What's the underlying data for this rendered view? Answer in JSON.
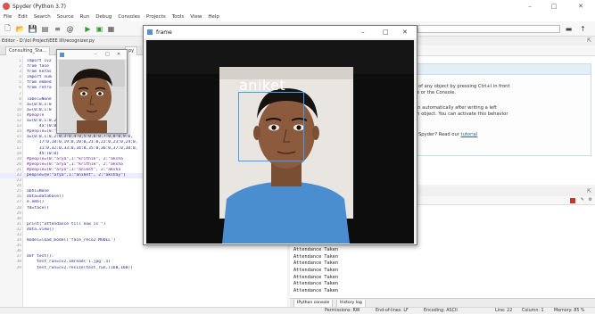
{
  "window": {
    "title": "Spyder (Python 3.7)",
    "controls": {
      "minimize": "–",
      "maximize": "□",
      "close": "✕"
    }
  },
  "menu": [
    "File",
    "Edit",
    "Search",
    "Source",
    "Run",
    "Debug",
    "Consoles",
    "Projects",
    "Tools",
    "View",
    "Help"
  ],
  "editor": {
    "path": "Editor - D:\\lol Project\\EEE III\\recognizer.py",
    "tab_label": "Consulting_Sta...",
    "tab_label2": "py",
    "lines": [
      {
        "n": "1",
        "t": "import cv2"
      },
      {
        "n": "2",
        "t": "from face"
      },
      {
        "n": "3",
        "t": "from keras"
      },
      {
        "n": "4",
        "t": "import num"
      },
      {
        "n": "5",
        "t": "from embed"
      },
      {
        "n": "6",
        "t": "from retra                     data"
      },
      {
        "n": "7",
        "t": ""
      },
      {
        "n": "8",
        "t": "label=None"
      },
      {
        "n": "9",
        "t": "a={0:0,1:0"
      },
      {
        "n": "10",
        "t": "a={0:0,1:0"
      },
      {
        "n": "11",
        "t": "#people"
      },
      {
        "n": "12",
        "t": "a={0:0,1:0,2:0,3:0,4:0"
      },
      {
        "n": "13",
        "t": "     4a:{0:0}"
      },
      {
        "n": "14",
        "t": "#people={0:\"vs\",1:\"rohit\",2:\"krlinin\",3:\""
      },
      {
        "n": "15",
        "t": "a={0:0,1:0,2:0,3:0,4:0,5:0,6:0,7:0,8:0,9:0,"
      },
      {
        "n": "16",
        "t": "     17:0,18:0,19:0,20:0,21:0,22:0,23:0,24:0,"
      },
      {
        "n": "17",
        "t": "     31:0,32:0,33:0,34:0,35:0,36:0,37:0,38:0,"
      },
      {
        "n": "18",
        "t": "     45:{0:0}"
      },
      {
        "n": "19",
        "t": "#people={0:\"arya\",1:\"krithik\", 2:\"aksha"
      },
      {
        "n": "20",
        "t": "#people={0:\"arya\",1:\"krithik\", 2:\"aksha"
      },
      {
        "n": "21",
        "t": "#people={0:\"arya\",1:\"aniket\", 2:\"aksha"
      },
      {
        "n": "22",
        "t": "people={0:\"arya\",1:\"aniket\", 2:\"akshay\"}"
      },
      {
        "n": "23",
        "t": ""
      },
      {
        "n": "24",
        "t": ""
      },
      {
        "n": "25",
        "t": "abhi=None"
      },
      {
        "n": "26",
        "t": "data=database()"
      },
      {
        "n": "27",
        "t": "e.emb()"
      },
      {
        "n": "28",
        "t": "fd=face()"
      },
      {
        "n": "29",
        "t": ""
      },
      {
        "n": "30",
        "t": ""
      },
      {
        "n": "31",
        "t": "print(\"attendance till now is \")"
      },
      {
        "n": "32",
        "t": "data.view()"
      },
      {
        "n": "33",
        "t": ""
      },
      {
        "n": "34",
        "t": "model=load_model('face_reco2.MODEL')"
      },
      {
        "n": "35",
        "t": ""
      },
      {
        "n": "36",
        "t": ""
      },
      {
        "n": "37",
        "t": "def test():"
      },
      {
        "n": "38",
        "t": "    test_run=cv2.imread('1.jpg',1)"
      },
      {
        "n": "39",
        "t": "    test_run=cv2.resize(test_run,(160,160))"
      }
    ]
  },
  "help_panel": {
    "line1": "p of any object by pressing Ctrl+I in front",
    "line2": "ile or the Console.",
    "line3": "wn automatically after writing a left",
    "line4": "an object. You can activate this behavior",
    "line5": "s.",
    "line6_prefix": "p Spyder? Read our ",
    "line6_link": "tutorial"
  },
  "frame_window": {
    "title": "frame",
    "label": "aniket"
  },
  "console": {
    "lines": [
      "Attendance Taken",
      "Attendance Taken",
      "Attendance Taken",
      "Attendance Taken",
      "Attendance Taken",
      "Attendance Taken",
      "Attendance Taken",
      "Attendance Taken",
      "Attendance Taken"
    ],
    "tabs": [
      "IPython console",
      "History log"
    ]
  },
  "status": {
    "permissions": "Permissions: RW",
    "eol": "End-of-lines: LF",
    "encoding": "Encoding: ASCII",
    "line": "Line: 22",
    "column": "Column: 1",
    "memory": "Memory: 85 %"
  },
  "colors": {
    "bbox": "#3aa0ff",
    "run": "#2e9c2e",
    "brand": "#d9534f"
  }
}
